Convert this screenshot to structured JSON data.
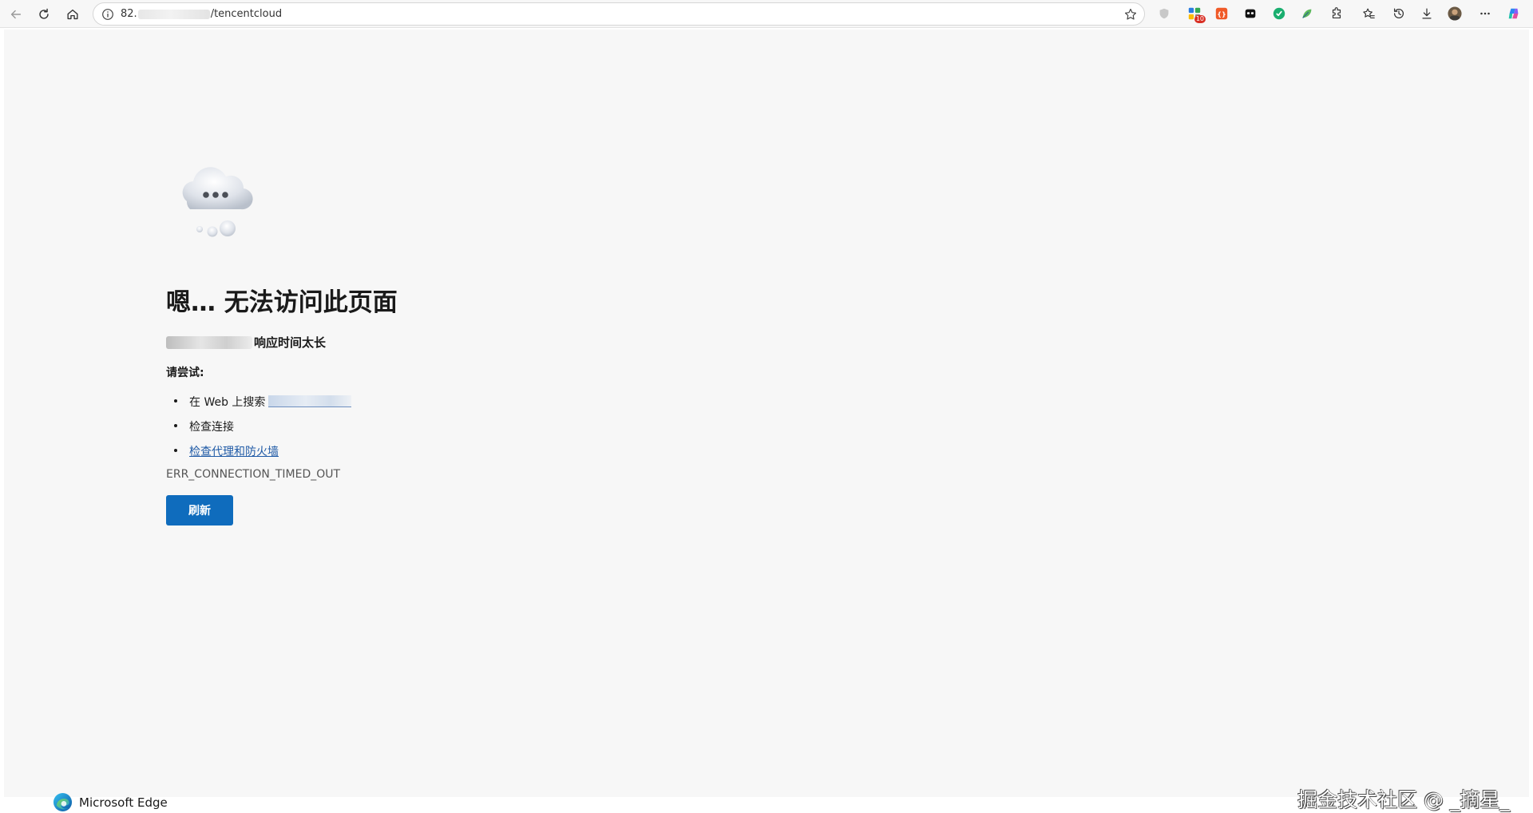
{
  "browser": {
    "address": {
      "prefix": "82.",
      "suffix": "/tencentcloud"
    },
    "icons": {
      "back": "arrow-left-icon",
      "refresh": "refresh-icon",
      "home": "home-icon",
      "info": "info-icon",
      "favorite": "star-icon",
      "extensions": "puzzle-icon",
      "favorites_bar": "favorites-icon",
      "history": "history-icon",
      "downloads": "download-icon",
      "more": "more-icon",
      "copilot": "copilot-icon"
    },
    "extension_badge": "10"
  },
  "error_page": {
    "heading": "嗯… 无法访问此页面",
    "description_suffix": "响应时间太长",
    "try_label": "请尝试:",
    "suggestions": {
      "search_prefix": "在 Web 上搜索",
      "check_connection": "检查连接",
      "check_proxy": "检查代理和防火墙"
    },
    "error_code": "ERR_CONNECTION_TIMED_OUT",
    "refresh_button": "刷新"
  },
  "footer": {
    "brand": "Microsoft Edge",
    "watermark": "掘金技术社区 @ _摘星_"
  },
  "colors": {
    "page_background": "#f7f7f7",
    "button_primary": "#0f6cbd",
    "link": "#1f5aa6"
  }
}
